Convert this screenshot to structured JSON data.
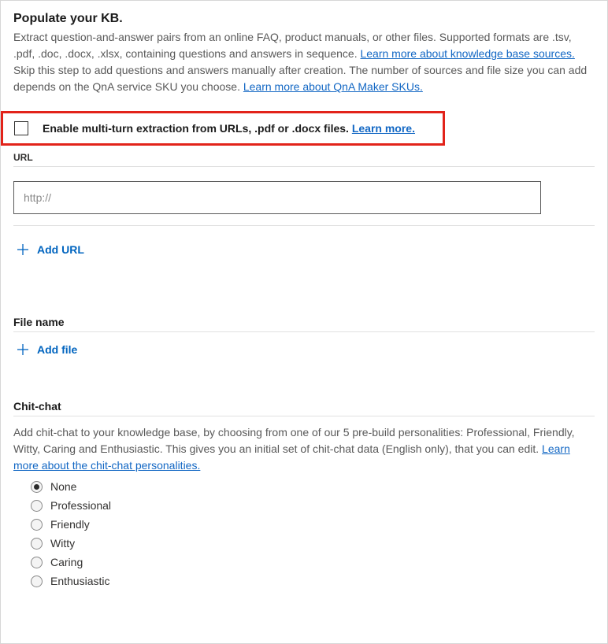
{
  "heading": "Populate your KB.",
  "description_part1": "Extract question-and-answer pairs from an online FAQ, product manuals, or other files. Supported formats are .tsv, .pdf, .doc, .docx, .xlsx, containing questions and answers in sequence. ",
  "link_kb_sources": "Learn more about knowledge base sources. ",
  "description_part2": "Skip this step to add questions and answers manually after creation. The number of sources and file size you can add depends on the QnA service SKU you choose. ",
  "link_sku": "Learn more about QnA Maker SKUs.",
  "multiturn": {
    "label": "Enable multi-turn extraction from URLs, .pdf or .docx files. ",
    "link": "Learn more."
  },
  "url_section": {
    "label": "URL",
    "placeholder": "http://",
    "add_button": "Add URL"
  },
  "file_section": {
    "label": "File name",
    "add_button": "Add file"
  },
  "chitchat": {
    "label": "Chit-chat",
    "description": "Add chit-chat to your knowledge base, by choosing from one of our 5 pre-build personalities: Professional, Friendly, Witty, Caring and Enthusiastic. This gives you an initial set of chit-chat data (English only), that you can edit. ",
    "link": "Learn more about the chit-chat personalities.",
    "options": [
      "None",
      "Professional",
      "Friendly",
      "Witty",
      "Caring",
      "Enthusiastic"
    ],
    "selected": "None"
  }
}
